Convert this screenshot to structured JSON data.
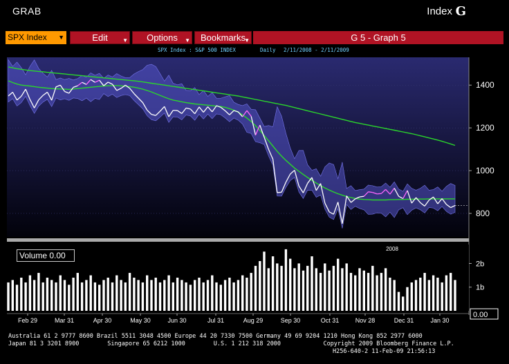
{
  "header": {
    "left": "GRAB",
    "right": "Index",
    "logo": "G"
  },
  "menu": {
    "ticker": "SPX Index",
    "edit": "Edit",
    "options": "Options",
    "bookmarks": "Bookmarks",
    "graph_title": "G 5 - Graph 5"
  },
  "subheader": {
    "security": "SPX Index : S&P 500 INDEX",
    "period": "Daily",
    "range": "2/11/2008 - 2/11/2009"
  },
  "volume": {
    "label": "Volume  0.00",
    "last_value": "0.00"
  },
  "colors": {
    "price": "#ffffff",
    "ma_short": "#2bd72b",
    "ma_long": "#2bd72b",
    "band": "#5555cc",
    "highlight": "#ff66ff",
    "volume": "#ffffff",
    "background_top": "#23235f"
  },
  "chart_data": {
    "type": "line",
    "price_axis": {
      "ticks": [
        800,
        1000,
        1200,
        1400
      ],
      "ylim": [
        690,
        1530
      ]
    },
    "volume_axis": {
      "ticks": [
        "1b",
        "2b"
      ],
      "ylim": [
        0,
        2.8
      ],
      "marker": "0.00"
    },
    "x_ticks": [
      "Feb 29",
      "Mar 31",
      "Apr 30",
      "May 30",
      "Jun 30",
      "Jul 31",
      "Aug 29",
      "Sep 30",
      "Oct 31",
      "Nov 28",
      "Dec 31",
      "Jan 30"
    ],
    "year_label": "2008",
    "series": [
      {
        "name": "",
        "values": [
          1349,
          1367,
          1330,
          1348,
          1381,
          1333,
          1293,
          1331,
          1352,
          1367,
          1329,
          1392,
          1400,
          1370,
          1362,
          1390,
          1397,
          1413,
          1403,
          1426,
          1413,
          1423,
          1397,
          1414,
          1404,
          1375,
          1385,
          1400,
          1385,
          1360,
          1339,
          1318,
          1283,
          1263,
          1258,
          1278,
          1300,
          1252,
          1282,
          1281,
          1267,
          1293,
          1288,
          1266,
          1298,
          1273,
          1299,
          1275,
          1304,
          1296,
          1280,
          1261,
          1281,
          1275,
          1252,
          1281,
          1254,
          1166,
          1213,
          1156,
          1100,
          1054,
          897,
          899,
          946,
          984,
          1002,
          928,
          896,
          941,
          968,
          907,
          940,
          848,
          807,
          796,
          853,
          752,
          882,
          851,
          868,
          877,
          880,
          901,
          898,
          891,
          893,
          912,
          890,
          918,
          880,
          869,
          907,
          848,
          874,
          850,
          834,
          862,
          877,
          845,
          869,
          842,
          827,
          837
        ]
      },
      {
        "name": "",
        "values": [
          1420,
          1412,
          1405,
          1400,
          1398,
          1396,
          1393,
          1390,
          1388,
          1386,
          1384,
          1383,
          1382,
          1381,
          1380,
          1382,
          1384,
          1386,
          1388,
          1390,
          1392,
          1394,
          1396,
          1397,
          1398,
          1398,
          1397,
          1395,
          1393,
          1390,
          1386,
          1381,
          1375,
          1368,
          1360,
          1352,
          1344,
          1336,
          1330,
          1326,
          1322,
          1318,
          1315,
          1312,
          1310,
          1308,
          1306,
          1304,
          1302,
          1300,
          1296,
          1290,
          1283,
          1273,
          1261,
          1246,
          1230,
          1210,
          1188,
          1164,
          1140,
          1115,
          1090,
          1068,
          1048,
          1030,
          1012,
          997,
          982,
          968,
          955,
          942,
          930,
          919,
          909,
          900,
          892,
          885,
          879,
          874,
          870,
          867,
          865,
          864,
          863,
          863,
          863,
          863,
          864,
          864,
          865,
          865,
          866,
          866,
          867,
          867,
          867,
          868,
          868,
          868,
          868,
          868,
          868,
          868
        ]
      },
      {
        "name": "",
        "values": [
          1485,
          1481,
          1477,
          1474,
          1471,
          1468,
          1466,
          1464,
          1462,
          1460,
          1458,
          1456,
          1454,
          1452,
          1450,
          1448,
          1446,
          1444,
          1442,
          1440,
          1438,
          1436,
          1434,
          1432,
          1430,
          1428,
          1426,
          1424,
          1422,
          1420,
          1418,
          1415,
          1412,
          1409,
          1406,
          1403,
          1400,
          1397,
          1394,
          1391,
          1388,
          1385,
          1382,
          1379,
          1376,
          1373,
          1370,
          1367,
          1364,
          1361,
          1358,
          1355,
          1352,
          1349,
          1345,
          1341,
          1337,
          1333,
          1329,
          1325,
          1321,
          1317,
          1313,
          1309,
          1305,
          1300,
          1295,
          1290,
          1285,
          1280,
          1275,
          1270,
          1265,
          1260,
          1255,
          1250,
          1245,
          1240,
          1235,
          1230,
          1225,
          1221,
          1217,
          1213,
          1209,
          1205,
          1201,
          1197,
          1193,
          1189,
          1185,
          1181,
          1177,
          1173,
          1168,
          1163,
          1158,
          1153,
          1148,
          1143,
          1137,
          1131,
          1125,
          1118
        ]
      }
    ],
    "volume_values": [
      1.2,
      1.3,
      1.1,
      1.4,
      1.2,
      1.5,
      1.3,
      1.6,
      1.2,
      1.4,
      1.3,
      1.2,
      1.5,
      1.3,
      1.1,
      1.4,
      1.6,
      1.2,
      1.3,
      1.5,
      1.2,
      1.1,
      1.3,
      1.4,
      1.2,
      1.5,
      1.3,
      1.2,
      1.6,
      1.4,
      1.3,
      1.2,
      1.5,
      1.3,
      1.4,
      1.2,
      1.3,
      1.5,
      1.2,
      1.4,
      1.3,
      1.2,
      1.1,
      1.3,
      1.4,
      1.2,
      1.3,
      1.5,
      1.2,
      1.1,
      1.3,
      1.4,
      1.2,
      1.3,
      1.5,
      1.4,
      1.6,
      1.9,
      2.1,
      2.5,
      1.8,
      2.3,
      2.0,
      1.9,
      2.6,
      2.2,
      1.8,
      2.0,
      1.7,
      1.9,
      2.3,
      1.8,
      1.6,
      2.0,
      1.7,
      1.9,
      2.2,
      1.8,
      2.0,
      1.6,
      1.5,
      1.8,
      1.7,
      1.6,
      1.9,
      1.5,
      1.6,
      1.8,
      1.4,
      1.3,
      0.8,
      0.6,
      1.0,
      1.2,
      1.3,
      1.4,
      1.6,
      1.3,
      1.5,
      1.4,
      1.2,
      1.5,
      1.6,
      1.3
    ]
  },
  "footer": {
    "line1": "Australia 61 2 9777 8600 Brazil 5511 3048 4500 Europe 44 20 7330 7500 Germany 49 69 9204 1210 Hong Kong 852 2977 6000",
    "line2": "Japan 81 3 3201 8900        Singapore 65 6212 1000        U.S. 1 212 318 2000            Copyright 2009 Bloomberg Finance L.P.",
    "line3": "H256-640-2 11-Feb-09 21:56:13"
  }
}
